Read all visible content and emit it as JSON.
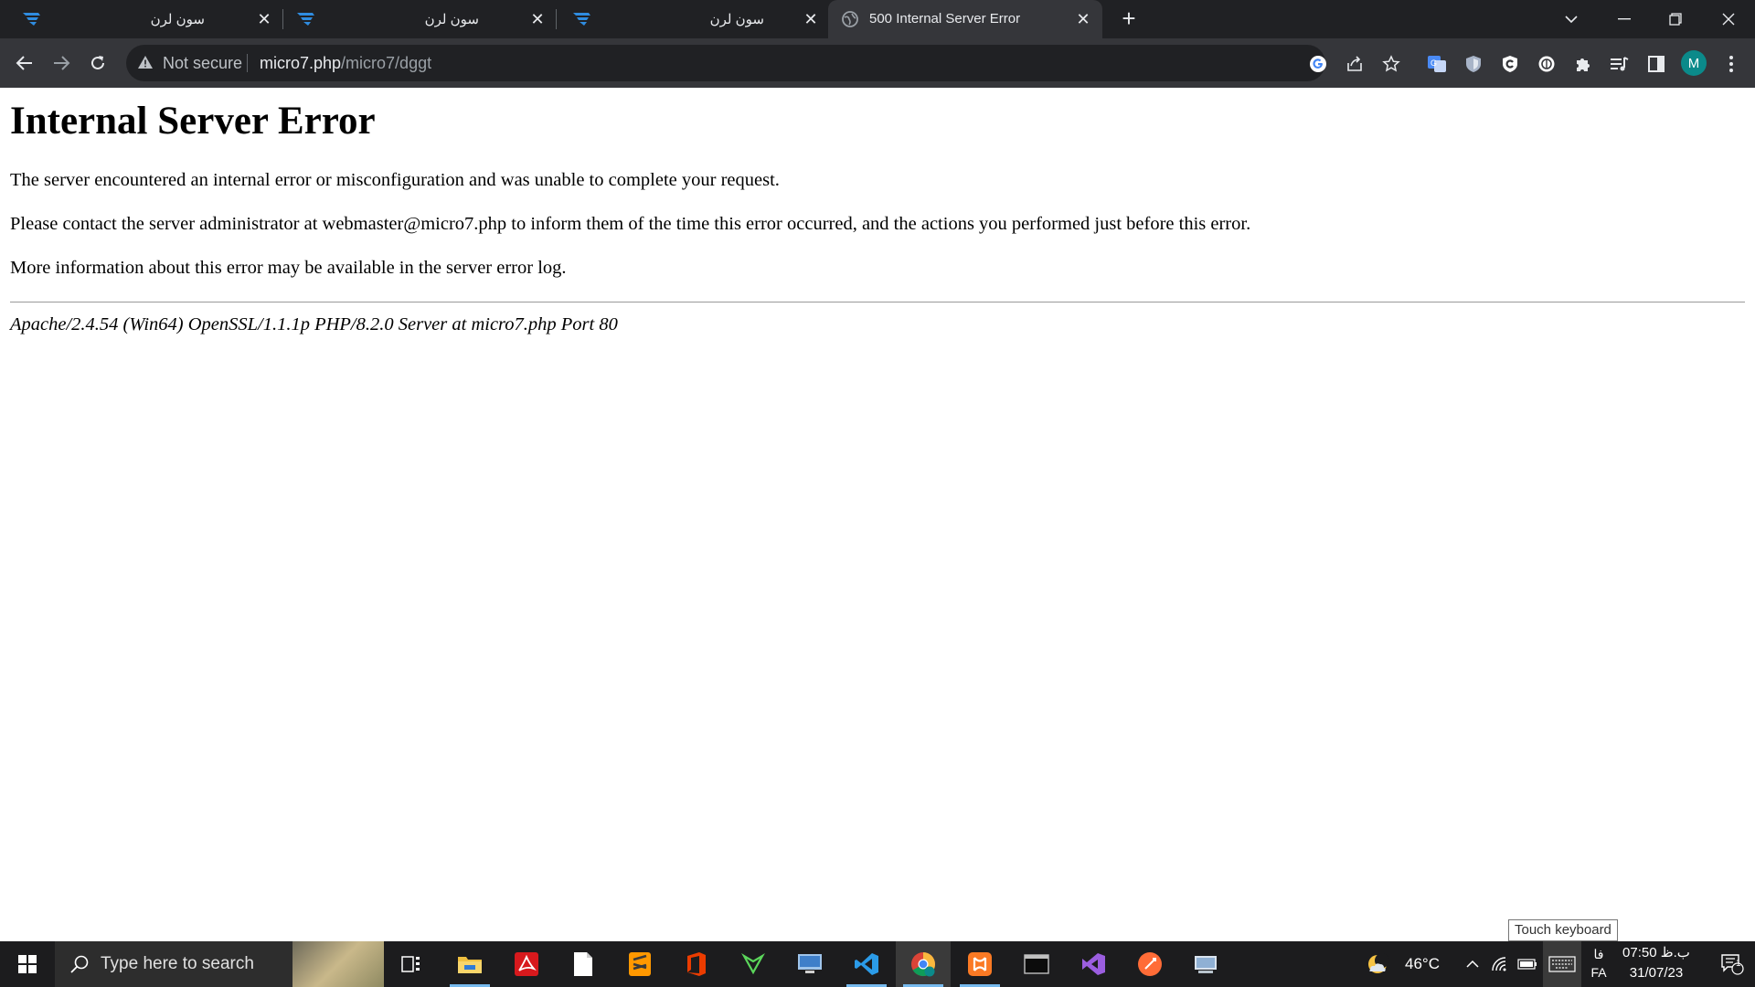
{
  "browser": {
    "tabs": [
      {
        "title": "سون لرن"
      },
      {
        "title": "سون لرن"
      },
      {
        "title": "سون لرن"
      },
      {
        "title": "500 Internal Server Error"
      }
    ],
    "close_glyph": "✕",
    "new_tab_glyph": "+",
    "omnibox": {
      "security_label": "Not secure",
      "url_host": "micro7.php",
      "url_path": "/micro7/dggt"
    },
    "profile_initial": "M"
  },
  "page": {
    "heading": "Internal Server Error",
    "paragraphs": [
      "The server encountered an internal error or misconfiguration and was unable to complete your request.",
      "Please contact the server administrator at webmaster@micro7.php to inform them of the time this error occurred, and the actions you performed just before this error.",
      "More information about this error may be available in the server error log."
    ],
    "server_signature": "Apache/2.4.54 (Win64) OpenSSL/1.1.1p PHP/8.2.0 Server at micro7.php Port 80"
  },
  "tooltip": "Touch keyboard",
  "taskbar": {
    "search_placeholder": "Type here to search",
    "weather_temp": "46°C",
    "language_top": "فا",
    "language_bottom": "FA",
    "time": "07:50 ب.ظ",
    "date": "31/07/23",
    "notification_count": "1"
  },
  "colors": {
    "tab_strip": "#202124",
    "toolbar": "#35363a",
    "omnibox": "#202124",
    "taskbar": "#1c1c1e",
    "avatar": "#0b8a8a"
  }
}
